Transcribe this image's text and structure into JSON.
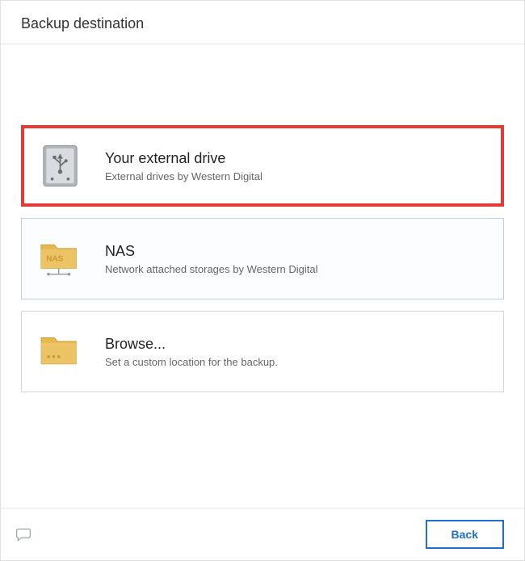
{
  "header": {
    "title": "Backup destination"
  },
  "options": {
    "external": {
      "title": "Your external drive",
      "desc": "External drives by Western Digital"
    },
    "nas": {
      "title": "NAS",
      "desc": "Network attached storages by Western Digital"
    },
    "browse": {
      "title": "Browse...",
      "desc": "Set a custom location for the backup."
    }
  },
  "footer": {
    "back_label": "Back"
  }
}
